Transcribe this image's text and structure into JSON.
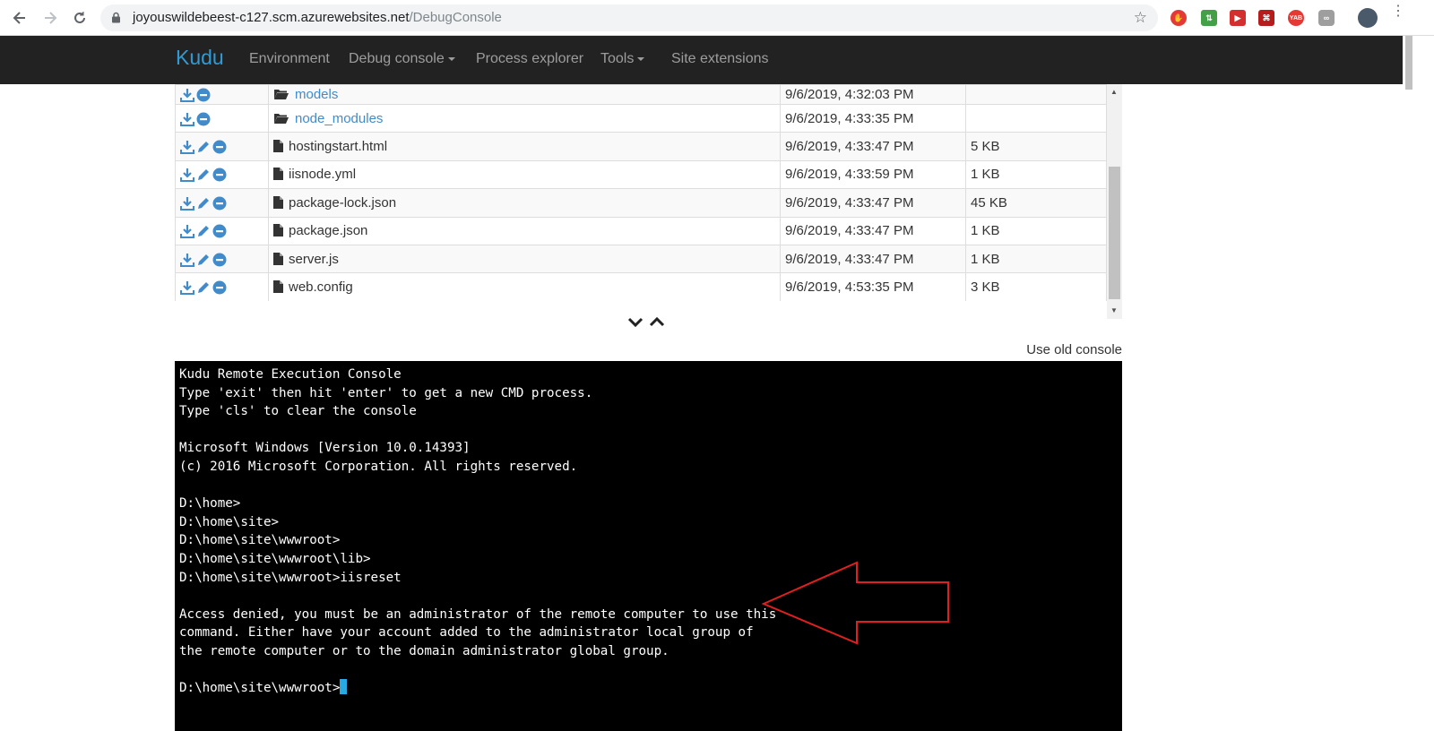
{
  "browser": {
    "url_host": "joyouswildebeest-c127.scm.azurewebsites.net",
    "url_path": "/DebugConsole"
  },
  "navbar": {
    "brand": "Kudu",
    "items": [
      {
        "label": "Environment"
      },
      {
        "label": "Debug console",
        "dropdown": true
      },
      {
        "label": "Process explorer"
      },
      {
        "label": "Tools",
        "dropdown": true
      },
      {
        "label": "Site extensions"
      }
    ]
  },
  "files": [
    {
      "name": "models",
      "type": "folder",
      "modified": "9/6/2019, 4:32:03 PM",
      "size": ""
    },
    {
      "name": "node_modules",
      "type": "folder",
      "modified": "9/6/2019, 4:33:35 PM",
      "size": ""
    },
    {
      "name": "hostingstart.html",
      "type": "file",
      "modified": "9/6/2019, 4:33:47 PM",
      "size": "5 KB"
    },
    {
      "name": "iisnode.yml",
      "type": "file",
      "modified": "9/6/2019, 4:33:59 PM",
      "size": "1 KB"
    },
    {
      "name": "package-lock.json",
      "type": "file",
      "modified": "9/6/2019, 4:33:47 PM",
      "size": "45 KB"
    },
    {
      "name": "package.json",
      "type": "file",
      "modified": "9/6/2019, 4:33:47 PM",
      "size": "1 KB"
    },
    {
      "name": "server.js",
      "type": "file",
      "modified": "9/6/2019, 4:33:47 PM",
      "size": "1 KB"
    },
    {
      "name": "web.config",
      "type": "file",
      "modified": "9/6/2019, 4:53:35 PM",
      "size": "3 KB"
    }
  ],
  "old_console_link": "Use old console",
  "console": {
    "lines": [
      "Kudu Remote Execution Console",
      "Type 'exit' then hit 'enter' to get a new CMD process.",
      "Type 'cls' to clear the console",
      "",
      "Microsoft Windows [Version 10.0.14393]",
      "(c) 2016 Microsoft Corporation. All rights reserved.",
      "",
      "D:\\home>",
      "D:\\home\\site>",
      "D:\\home\\site\\wwwroot>",
      "D:\\home\\site\\wwwroot\\lib>",
      "D:\\home\\site\\wwwroot>iisreset",
      "",
      "Access denied, you must be an administrator of the remote computer to use this",
      "command. Either have your account added to the administrator local group of",
      "the remote computer or to the domain administrator global group.",
      ""
    ],
    "prompt": "D:\\home\\site\\wwwroot>"
  },
  "colors": {
    "navbar_bg": "#222222",
    "link": "#428bca",
    "action_icon": "#428bca",
    "console_bg": "#000000",
    "cursor": "#27a9e3",
    "annotation_arrow": "#e02020"
  },
  "ext_badges": [
    "YAB"
  ]
}
